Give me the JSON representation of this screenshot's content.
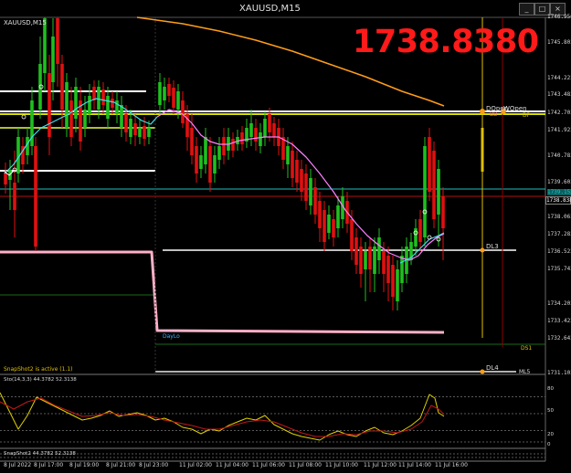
{
  "window": {
    "title": "XAUUSD,M15",
    "symbol_label": "XAUUSD,M15",
    "buttons": [
      "_",
      "□",
      "×"
    ]
  },
  "bid_display": "1738.8380",
  "price_axis": [
    {
      "label": "1746.950",
      "price": 1746.95
    },
    {
      "label": "1745.802",
      "price": 1745.802
    },
    {
      "label": "1744.222",
      "price": 1744.222
    },
    {
      "label": "1743.482",
      "price": 1743.482
    },
    {
      "label": "1742.702",
      "price": 1742.702
    },
    {
      "label": "1741.922",
      "price": 1741.922
    },
    {
      "label": "1740.782",
      "price": 1740.782
    },
    {
      "label": "1739.602",
      "price": 1739.602
    },
    {
      "label": "1738.062",
      "price": 1738.062
    },
    {
      "label": "1737.282",
      "price": 1737.282
    },
    {
      "label": "1736.522",
      "price": 1736.522
    },
    {
      "label": "1735.742",
      "price": 1735.742
    },
    {
      "label": "1734.202",
      "price": 1734.202
    },
    {
      "label": "1733.422",
      "price": 1733.422
    },
    {
      "label": "1732.642",
      "price": 1732.642
    },
    {
      "label": "1731.102",
      "price": 1731.102
    }
  ],
  "price_tags": [
    {
      "label": "1739.152",
      "price": 1739.152,
      "color": "#20c0c0"
    },
    {
      "label": "1738.838",
      "price": 1738.838,
      "color": "#ffffff"
    }
  ],
  "time_axis": [
    "8 Jul 2022",
    "8 Jul 17:00",
    "8 Jul 19:00",
    "8 Jul 21:00",
    "8 Jul 23:00",
    "11 Jul 02:00",
    "11 Jul 04:00",
    "11 Jul 06:00",
    "11 Jul 08:00",
    "11 Jul 10:00",
    "11 Jul 12:00",
    "11 Jul 14:00",
    "11 Jul 16:00"
  ],
  "chart_labels": {
    "dopen": "DOpen",
    "wopen": "WOpen",
    "bb": "BB",
    "dp": "DP",
    "dl3": "DL3",
    "daylo": "DayLo",
    "ds1": "DS1",
    "dl4": "DL4",
    "ml5": "ML5",
    "snapshot": "SnapShot2 is active (1.1)"
  },
  "stoch": {
    "header": "Sto(14,3,3) 44.3782 52.3138",
    "levels": [
      "80",
      "50",
      "20",
      "0"
    ]
  },
  "sub2_header": "SnapShot2 44.3782 52.3138",
  "colors": {
    "bull": "#1fbf1f",
    "bear": "#e01010",
    "ema_orange": "#ff9d1a",
    "bb_mid": "#ff80ff",
    "cyan": "#40e0f0",
    "daylo_line": "#ffb0c8",
    "gold": "#e0c000",
    "stoch_main": "#e0d000",
    "stoch_signal": "#c01818"
  }
}
